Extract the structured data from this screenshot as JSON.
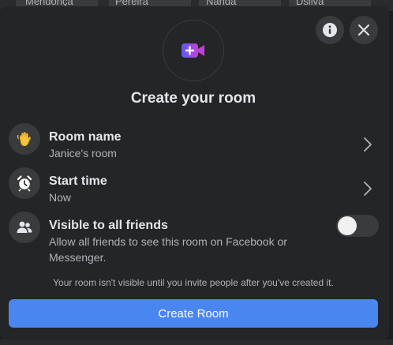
{
  "background": {
    "names": [
      "Mendonça",
      "Pereira",
      "Nanda",
      "Dsilva"
    ]
  },
  "modal": {
    "title": "Create your room",
    "icons": {
      "info": "info-icon",
      "close": "close-icon",
      "hero": "add-video-icon"
    },
    "rows": [
      {
        "icon": "waving-hand-icon",
        "label": "Room name",
        "value": "Janice's room",
        "has_chevron": true
      },
      {
        "icon": "alarm-clock-icon",
        "label": "Start time",
        "value": "Now",
        "has_chevron": true
      },
      {
        "icon": "friends-icon",
        "label": "Visible to all friends",
        "value": "Allow all friends to see this room on Facebook or Messenger.",
        "toggle_on": false
      }
    ],
    "note": "Your room isn't visible until you invite people after you've created it.",
    "create_label": "Create Room"
  },
  "colors": {
    "primary": "#4a86f0",
    "surface": "#242526",
    "chip": "#3a3b3c"
  }
}
